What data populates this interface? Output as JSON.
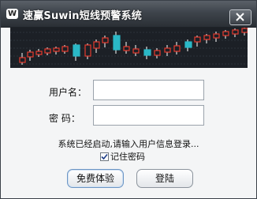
{
  "window": {
    "title": "速赢Suwin短线预警系统",
    "app_icon_text": "W",
    "icon_names": [
      "w-logo-icon",
      "close-icon"
    ]
  },
  "form": {
    "username_label": "用户名：",
    "username_value": "",
    "password_label": "密  码：",
    "password_value": ""
  },
  "status_text": "系统已经启动,请输入用户信息登录...",
  "remember": {
    "label": "记住密码",
    "checked": true
  },
  "buttons": {
    "trial": "免费体验",
    "login": "登陆"
  },
  "colors": {
    "title_bar": "#3e444b",
    "chart_bg": "#1c2026",
    "candle_up": "#e63a2e",
    "candle_down": "#2ab8c7",
    "wick": "#ffffff"
  }
}
